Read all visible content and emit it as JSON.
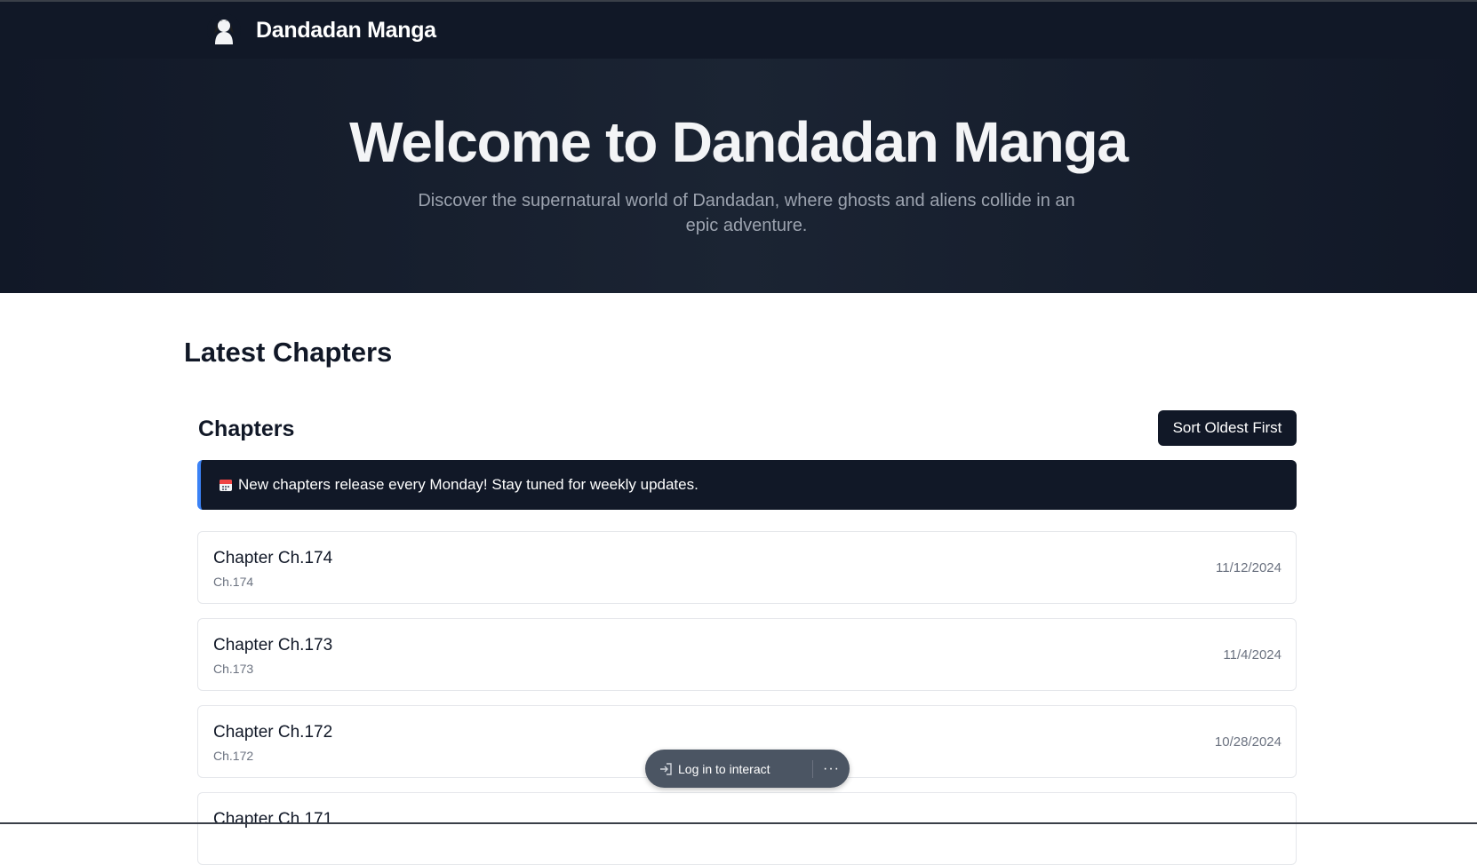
{
  "header": {
    "brand_name": "Dandadan Manga",
    "logo_icon": "character-avatar-icon"
  },
  "hero": {
    "title": "Welcome to Dandadan Manga",
    "subtitle": "Discover the supernatural world of Dandadan, where ghosts and aliens collide in an epic adventure."
  },
  "main": {
    "section_title": "Latest Chapters",
    "chapters_heading": "Chapters",
    "sort_button_label": "Sort Oldest First",
    "notice": {
      "icon": "calendar-icon",
      "text": "New chapters release every Monday! Stay tuned for weekly updates."
    },
    "chapters": [
      {
        "title": "Chapter Ch.174",
        "number": "Ch.174",
        "date": "11/12/2024"
      },
      {
        "title": "Chapter Ch.173",
        "number": "Ch.173",
        "date": "11/4/2024"
      },
      {
        "title": "Chapter Ch.172",
        "number": "Ch.172",
        "date": "10/28/2024"
      },
      {
        "title": "Chapter Ch.171",
        "number": "",
        "date": ""
      }
    ]
  },
  "overlay": {
    "login_label": "Log in to interact",
    "more_label": "···"
  },
  "colors": {
    "header_bg": "#111827",
    "accent": "#3b82f6",
    "text_dark": "#111827",
    "text_muted": "#6b7280"
  }
}
